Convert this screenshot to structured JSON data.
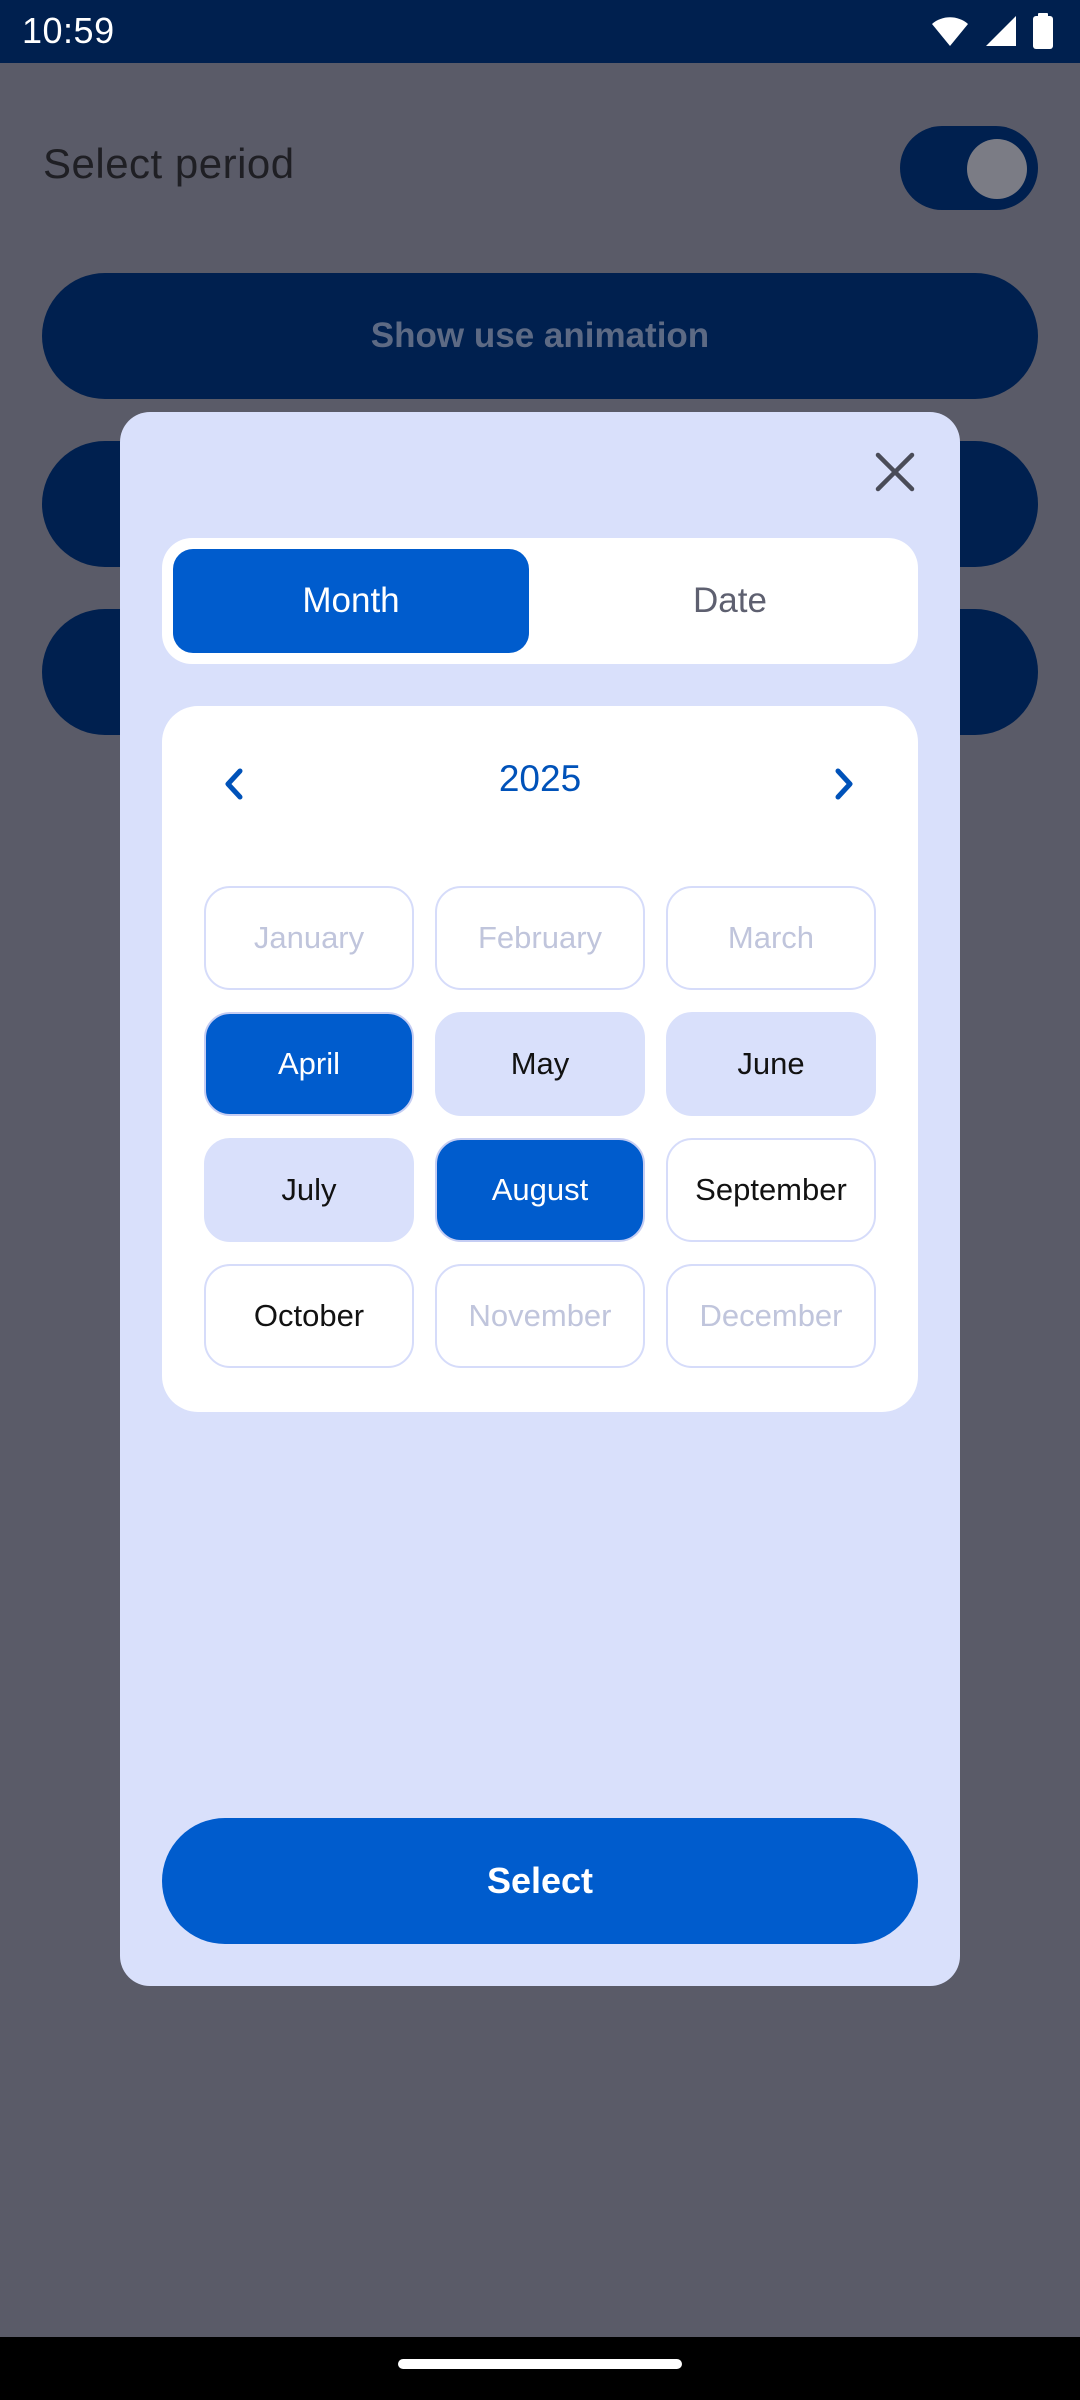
{
  "status_bar": {
    "time": "10:59",
    "icons": [
      "wifi-icon",
      "cellular-signal-icon",
      "battery-icon"
    ]
  },
  "background": {
    "title": "Select period",
    "toggle_on": true,
    "buttons": [
      "Show use animation",
      "",
      ""
    ]
  },
  "dialog": {
    "tabs": {
      "month": "Month",
      "date": "Date",
      "active": "Month"
    },
    "year": "2025",
    "months": [
      {
        "label": "January",
        "state": "disabled"
      },
      {
        "label": "February",
        "state": "disabled"
      },
      {
        "label": "March",
        "state": "disabled"
      },
      {
        "label": "April",
        "state": "selected"
      },
      {
        "label": "May",
        "state": "in-range"
      },
      {
        "label": "June",
        "state": "in-range"
      },
      {
        "label": "July",
        "state": "in-range"
      },
      {
        "label": "August",
        "state": "selected"
      },
      {
        "label": "September",
        "state": "normal"
      },
      {
        "label": "October",
        "state": "normal"
      },
      {
        "label": "November",
        "state": "disabled"
      },
      {
        "label": "December",
        "state": "disabled"
      }
    ],
    "select_label": "Select"
  },
  "colors": {
    "primary": "#005ccd",
    "dark_navy": "#00204f",
    "dialog_bg": "#d9e0fb",
    "scrim_bg": "#5a5b68"
  }
}
